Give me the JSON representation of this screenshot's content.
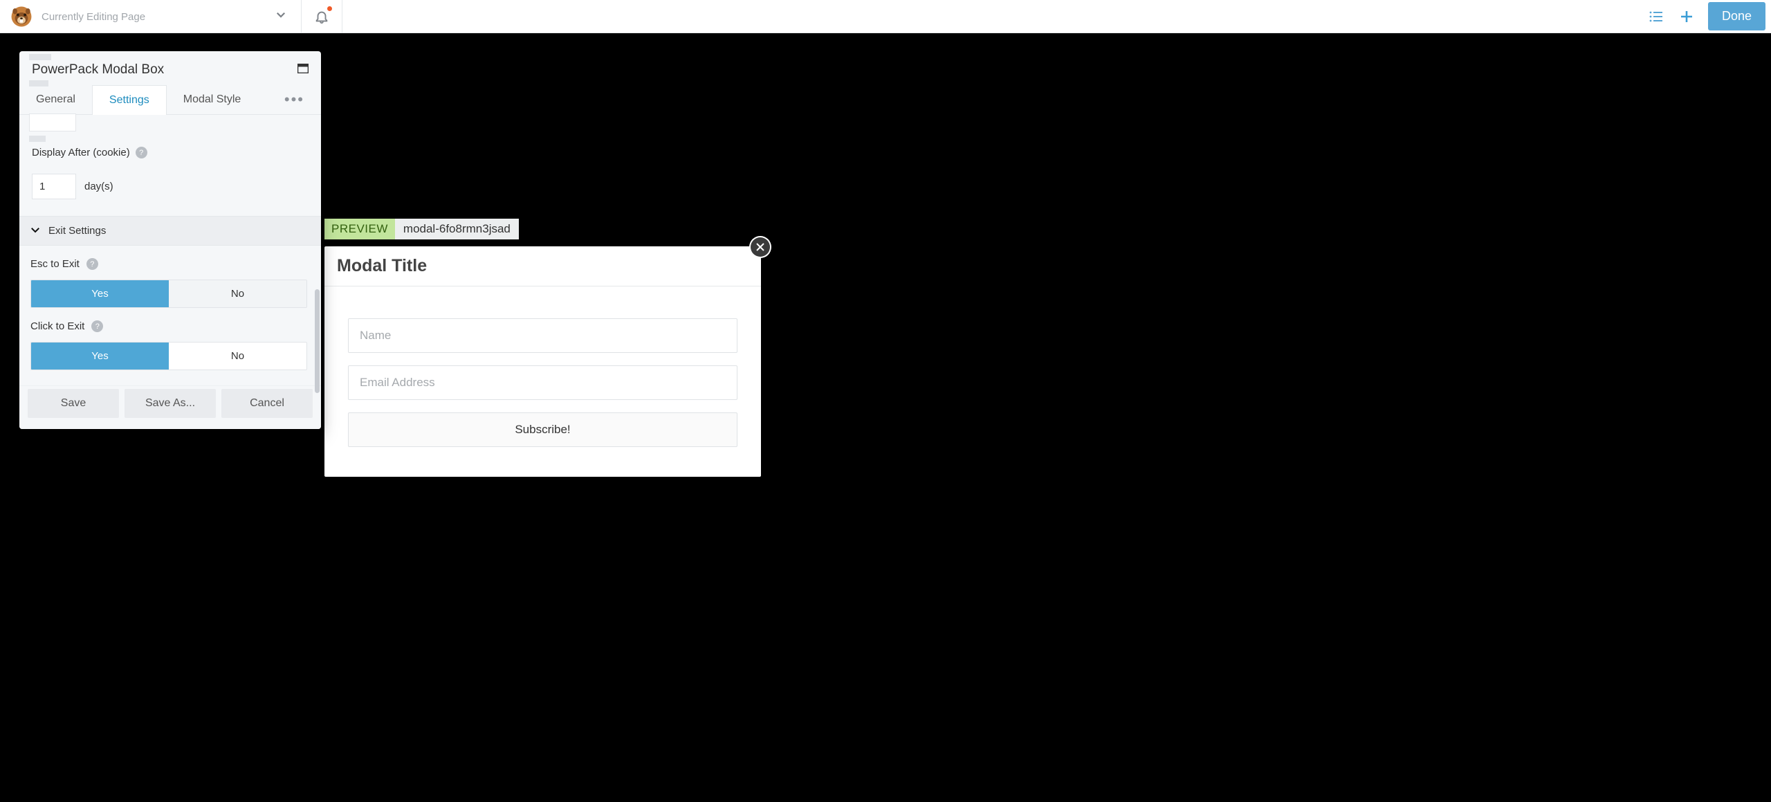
{
  "topbar": {
    "page_title": "Currently Editing Page",
    "done_label": "Done"
  },
  "panel": {
    "title": "PowerPack Modal Box",
    "tabs": {
      "general": "General",
      "settings": "Settings",
      "modal_style": "Modal Style"
    },
    "display_after": {
      "label": "Display After (cookie)",
      "value": "1",
      "unit": "day(s)"
    },
    "exit_section_title": "Exit Settings",
    "esc_to_exit": {
      "label": "Esc to Exit",
      "yes": "Yes",
      "no": "No"
    },
    "click_to_exit": {
      "label": "Click to Exit",
      "yes": "Yes",
      "no": "No"
    },
    "footer": {
      "save": "Save",
      "save_as": "Save As...",
      "cancel": "Cancel"
    }
  },
  "preview": {
    "badge": "PREVIEW",
    "modal_id": "modal-6fo8rmn3jsad"
  },
  "modal_preview": {
    "title": "Modal Title",
    "name_placeholder": "Name",
    "email_placeholder": "Email Address",
    "subscribe_label": "Subscribe!"
  }
}
